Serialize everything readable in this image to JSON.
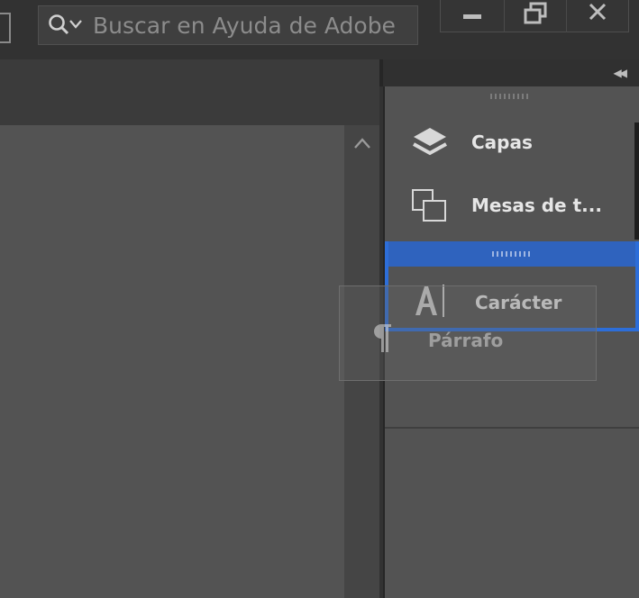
{
  "search": {
    "placeholder": "Buscar en Ayuda de Adobe"
  },
  "window_controls": {
    "icons": [
      "minimize-icon",
      "restore-icon",
      "close-icon"
    ]
  },
  "panels": {
    "items": [
      {
        "label": "Capas",
        "icon": "layers-icon"
      },
      {
        "label": "Mesas de t...",
        "icon": "artboards-icon"
      },
      {
        "label": "Carácter",
        "icon": "character-icon"
      }
    ],
    "dragged": {
      "label": "Párrafo",
      "icon": "pilcrow-icon"
    }
  },
  "colors": {
    "drop_highlight": "#2d6ed9",
    "panel_bg": "#535353",
    "title_bg": "#323232"
  }
}
